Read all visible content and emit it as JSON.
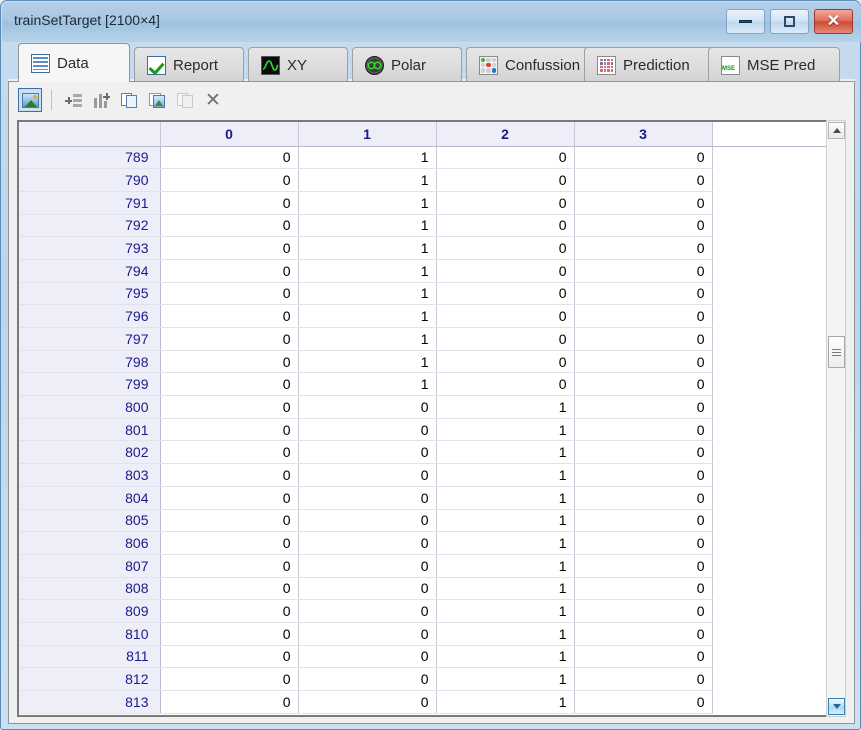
{
  "window": {
    "title": "trainSetTarget [2100×4]",
    "buttons": {
      "minimize": "Minimize",
      "restore": "Restore",
      "close": "Close",
      "close_glyph": "✕"
    }
  },
  "tabs": [
    {
      "label": "Data",
      "icon": "data-grid-icon",
      "active": true
    },
    {
      "label": "Report",
      "icon": "check-icon",
      "active": false
    },
    {
      "label": "XY",
      "icon": "waveform-icon",
      "active": false
    },
    {
      "label": "Polar",
      "icon": "polar-plot-icon",
      "active": false
    },
    {
      "label": "Confussion",
      "icon": "confusion-dots-icon",
      "active": false
    },
    {
      "label": "Prediction",
      "icon": "prediction-grid-icon",
      "active": false
    },
    {
      "label": "MSE Pred",
      "icon": "mse-grid-icon",
      "active": false,
      "icon_text": "MSE"
    }
  ],
  "toolbar": [
    {
      "name": "plot-image-button",
      "icon": "picture-icon",
      "selected": true
    },
    {
      "name": "insert-row-button",
      "icon": "insert-row-icon",
      "selected": false
    },
    {
      "name": "insert-column-button",
      "icon": "insert-column-icon",
      "selected": false
    },
    {
      "name": "copy-button",
      "icon": "copy-icon",
      "selected": false
    },
    {
      "name": "copy-image-button",
      "icon": "copy-image-icon",
      "selected": false
    },
    {
      "name": "paste-button",
      "icon": "clipboard-icon",
      "selected": false
    },
    {
      "name": "delete-button",
      "icon": "close-x-icon",
      "selected": false,
      "glyph": "✕"
    }
  ],
  "table": {
    "columns": [
      "0",
      "1",
      "2",
      "3"
    ],
    "rows": [
      {
        "index": "789",
        "values": [
          "0",
          "1",
          "0",
          "0"
        ]
      },
      {
        "index": "790",
        "values": [
          "0",
          "1",
          "0",
          "0"
        ]
      },
      {
        "index": "791",
        "values": [
          "0",
          "1",
          "0",
          "0"
        ]
      },
      {
        "index": "792",
        "values": [
          "0",
          "1",
          "0",
          "0"
        ]
      },
      {
        "index": "793",
        "values": [
          "0",
          "1",
          "0",
          "0"
        ]
      },
      {
        "index": "794",
        "values": [
          "0",
          "1",
          "0",
          "0"
        ]
      },
      {
        "index": "795",
        "values": [
          "0",
          "1",
          "0",
          "0"
        ]
      },
      {
        "index": "796",
        "values": [
          "0",
          "1",
          "0",
          "0"
        ]
      },
      {
        "index": "797",
        "values": [
          "0",
          "1",
          "0",
          "0"
        ]
      },
      {
        "index": "798",
        "values": [
          "0",
          "1",
          "0",
          "0"
        ]
      },
      {
        "index": "799",
        "values": [
          "0",
          "1",
          "0",
          "0"
        ]
      },
      {
        "index": "800",
        "values": [
          "0",
          "0",
          "1",
          "0"
        ]
      },
      {
        "index": "801",
        "values": [
          "0",
          "0",
          "1",
          "0"
        ]
      },
      {
        "index": "802",
        "values": [
          "0",
          "0",
          "1",
          "0"
        ]
      },
      {
        "index": "803",
        "values": [
          "0",
          "0",
          "1",
          "0"
        ]
      },
      {
        "index": "804",
        "values": [
          "0",
          "0",
          "1",
          "0"
        ]
      },
      {
        "index": "805",
        "values": [
          "0",
          "0",
          "1",
          "0"
        ]
      },
      {
        "index": "806",
        "values": [
          "0",
          "0",
          "1",
          "0"
        ]
      },
      {
        "index": "807",
        "values": [
          "0",
          "0",
          "1",
          "0"
        ]
      },
      {
        "index": "808",
        "values": [
          "0",
          "0",
          "1",
          "0"
        ]
      },
      {
        "index": "809",
        "values": [
          "0",
          "0",
          "1",
          "0"
        ]
      },
      {
        "index": "810",
        "values": [
          "0",
          "0",
          "1",
          "0"
        ]
      },
      {
        "index": "811",
        "values": [
          "0",
          "0",
          "1",
          "0"
        ]
      },
      {
        "index": "812",
        "values": [
          "0",
          "0",
          "1",
          "0"
        ]
      },
      {
        "index": "813",
        "values": [
          "0",
          "0",
          "1",
          "0"
        ]
      }
    ]
  },
  "scrollbar": {
    "up_arrow": "▲",
    "down_arrow": "▼"
  },
  "colors": {
    "header_bg": "#eeeef8",
    "header_text": "#1a1a8c",
    "accent": "#3c7fb1",
    "close_red": "#cf4a34"
  }
}
